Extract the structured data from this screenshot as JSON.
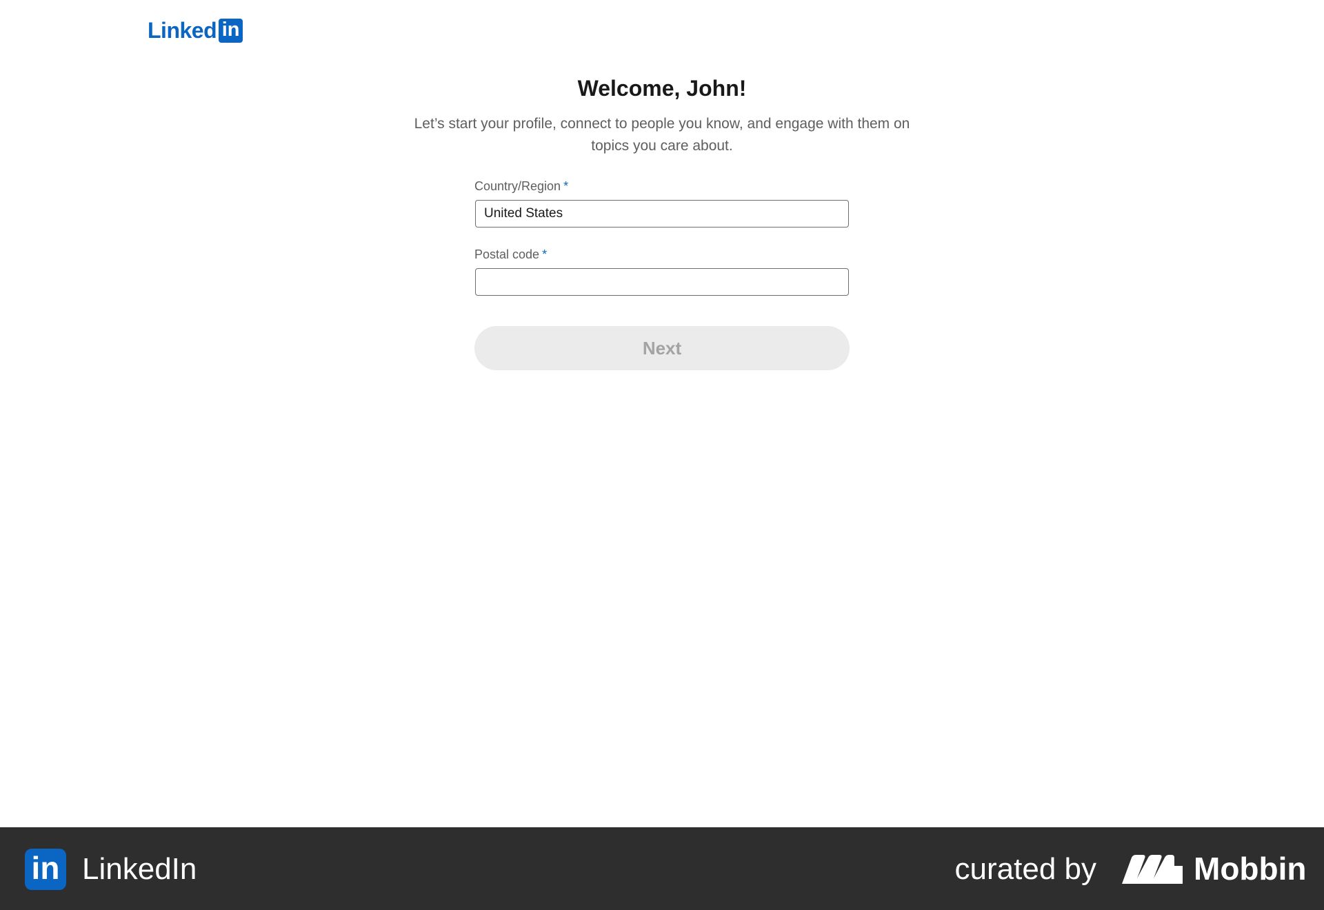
{
  "header": {
    "logo_wordmark": "Linked",
    "logo_box": "in"
  },
  "main": {
    "title": "Welcome, John!",
    "subtitle": "Let’s start your profile, connect to people you know, and engage with them on topics you care about."
  },
  "form": {
    "country": {
      "label": "Country/Region",
      "required_mark": "*",
      "value": "United States"
    },
    "postal": {
      "label": "Postal code",
      "required_mark": "*",
      "value": ""
    },
    "next_label": "Next"
  },
  "footer": {
    "app_icon_text": "in",
    "app_name": "LinkedIn",
    "curated_by": "curated by",
    "brand_name": "Mobbin"
  },
  "colors": {
    "brand_blue": "#0a66c2",
    "footer_bg": "#2e2e2e",
    "button_disabled_bg": "#ebebeb",
    "button_disabled_text": "#a3a3a3"
  }
}
